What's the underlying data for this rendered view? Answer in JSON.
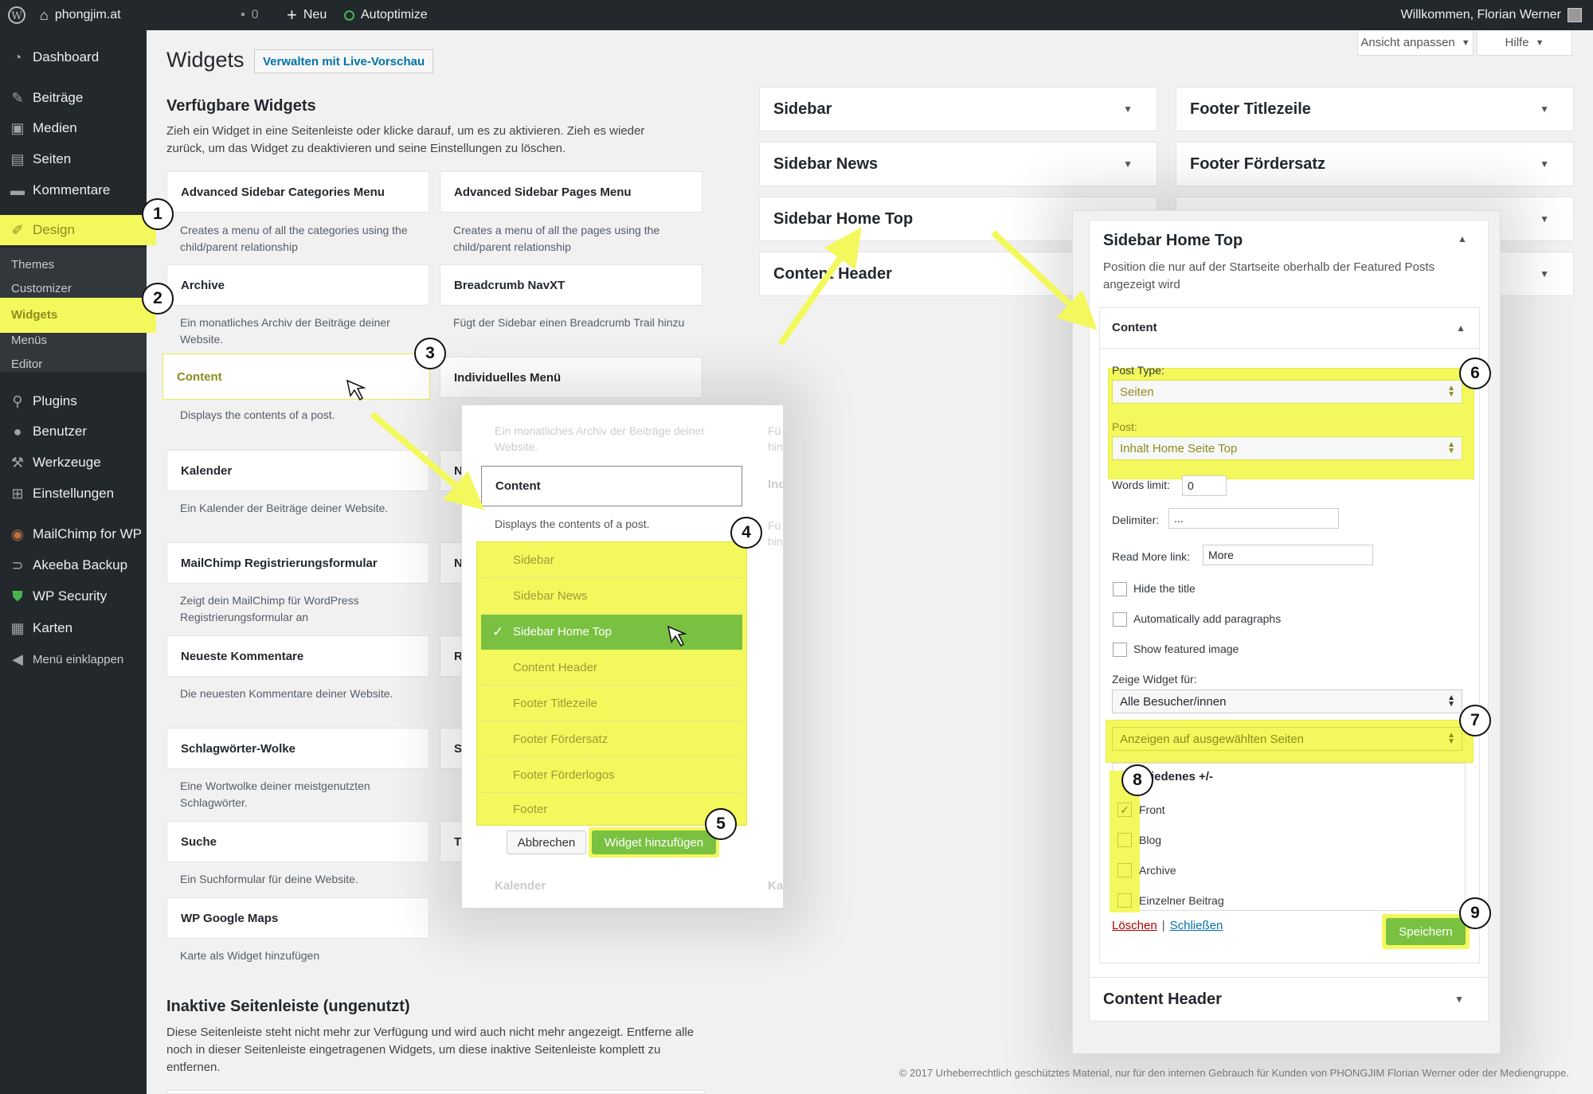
{
  "adminbar": {
    "site_name": "phongjim.at",
    "comments_count": "0",
    "new_label": "Neu",
    "autoptimize_label": "Autoptimize",
    "welcome": "Willkommen, Florian Werner"
  },
  "sidebar": {
    "items": [
      {
        "label": "Dashboard",
        "icon": "dashboard-icon"
      },
      {
        "label": "Beiträge",
        "icon": "pin-icon"
      },
      {
        "label": "Medien",
        "icon": "media-icon"
      },
      {
        "label": "Seiten",
        "icon": "pages-icon"
      },
      {
        "label": "Kommentare",
        "icon": "comments-icon"
      },
      {
        "label": "Design",
        "icon": "brush-icon"
      },
      {
        "label": "Plugins",
        "icon": "plugin-icon"
      },
      {
        "label": "Benutzer",
        "icon": "user-icon"
      },
      {
        "label": "Werkzeuge",
        "icon": "wrench-icon"
      },
      {
        "label": "Einstellungen",
        "icon": "settings-icon"
      },
      {
        "label": "MailChimp for WP",
        "icon": "mailchimp-icon"
      },
      {
        "label": "Akeeba Backup",
        "icon": "backup-icon"
      },
      {
        "label": "WP Security",
        "icon": "shield-icon"
      },
      {
        "label": "Karten",
        "icon": "map-icon"
      },
      {
        "label": "Menü einklappen",
        "icon": "collapse-icon"
      }
    ],
    "design_sub": [
      "Themes",
      "Customizer",
      "Widgets",
      "Menüs",
      "Editor"
    ]
  },
  "header": {
    "title": "Widgets",
    "live_preview": "Verwalten mit Live-Vorschau",
    "screen_options": "Ansicht anpassen",
    "help": "Hilfe"
  },
  "available": {
    "heading": "Verfügbare Widgets",
    "intro": "Zieh ein Widget in eine Seitenleiste oder klicke darauf, um es zu aktivieren. Zieh es wieder zurück, um das Widget zu deaktivieren und seine Einstellungen zu löschen.",
    "left": [
      {
        "name": "Advanced Sidebar Categories Menu",
        "desc": "Creates a menu of all the categories using the child/parent relationship"
      },
      {
        "name": "Archive",
        "desc": "Ein monatliches Archiv der Beiträge deiner Website."
      },
      {
        "name": "Content",
        "desc": "Displays the contents of a post."
      },
      {
        "name": "Kalender",
        "desc": "Ein Kalender der Beiträge deiner Website."
      },
      {
        "name": "MailChimp Registrierungsformular",
        "desc": "Zeigt dein MailChimp für WordPress Registrierungsformular an"
      },
      {
        "name": "Neueste Kommentare",
        "desc": "Die neuesten Kommentare deiner Website."
      },
      {
        "name": "Schlagwörter-Wolke",
        "desc": "Eine Wortwolke deiner meistgenutzten Schlagwörter."
      },
      {
        "name": "Suche",
        "desc": "Ein Suchformular für deine Website."
      },
      {
        "name": "WP Google Maps",
        "desc": "Karte als Widget hinzufügen"
      }
    ],
    "right": [
      {
        "name": "Advanced Sidebar Pages Menu",
        "desc": "Creates a menu of all the pages using the child/parent relationship"
      },
      {
        "name": "Breadcrumb NavXT",
        "desc": "Fügt der Sidebar einen Breadcrumb Trail hinzu"
      },
      {
        "name": "Individuelles Menü",
        "desc": ""
      }
    ]
  },
  "inactive": {
    "heading": "Inaktive Seitenleiste (ungenutzt)",
    "text": "Diese Seitenleiste steht nicht mehr zur Verfügung und wird auch nicht mehr angezeigt. Entferne alle noch in dieser Seitenleiste eingetragenen Widgets, um diese inaktive Seitenleiste komplett zu entfernen."
  },
  "areas": {
    "col1": [
      "Sidebar",
      "Sidebar News",
      "Sidebar Home Top",
      "Content Header"
    ],
    "col2": [
      "Footer Titlezeile",
      "Footer Fördersatz"
    ]
  },
  "popup": {
    "faded_top": "Ein monatliches Archiv der Beiträge deiner Website.",
    "widget_name": "Content",
    "widget_desc": "Displays the contents of a post.",
    "options": [
      "Sidebar",
      "Sidebar News",
      "Sidebar Home Top",
      "Content Header",
      "Footer Titlezeile",
      "Footer Fördersatz",
      "Footer Förderlogos",
      "Footer"
    ],
    "selected_index": 2,
    "cancel": "Abbrechen",
    "add": "Widget hinzufügen",
    "faded_bottom": "Kalender",
    "faded_right_top": "Fü",
    "faded_right_top2": "hin",
    "faded_right_mid": "Ind",
    "faded_right_low": "Fü",
    "faded_right_low2": "hin",
    "faded_right_bottom": "Ka"
  },
  "panel": {
    "title": "Sidebar Home Top",
    "desc": "Position die nur auf der Startseite oberhalb der Featured Posts angezeigt wird",
    "widget_title": "Content",
    "post_type_label": "Post Type:",
    "post_type_value": "Seiten",
    "post_label": "Post:",
    "post_value": "Inhalt Home Seite Top",
    "words_label": "Words limit:",
    "words_value": "0",
    "delimiter_label": "Delimiter:",
    "delimiter_value": "...",
    "readmore_label": "Read More link:",
    "readmore_value": "More",
    "hide_title": "Hide the title",
    "auto_par": "Automatically add paragraphs",
    "show_img": "Show featured image",
    "show_for_label": "Zeige Widget für:",
    "show_for_value": "Alle Besucher/innen",
    "display_value": "Anzeigen auf ausgewählten Seiten",
    "misc_label": "iedenes +/-",
    "pages": [
      "Front",
      "Blog",
      "Archive",
      "Einzelner Beitrag"
    ],
    "delete": "Löschen",
    "sep": "|",
    "close": "Schließen",
    "save": "Speichern",
    "next_area": "Content Header"
  },
  "circles": [
    "1",
    "2",
    "3",
    "4",
    "5",
    "6",
    "7",
    "8",
    "9"
  ],
  "footer_note": "© 2017 Urheberrechtlich geschütztes Material, nur für den internen Gebrauch für Kunden von PHONGJIM Florian Werner oder der Mediengruppe.",
  "colors": {
    "highlight": "#f3f85c",
    "green": "#7ac142",
    "admin_dark": "#23282d",
    "link": "#0073aa"
  }
}
